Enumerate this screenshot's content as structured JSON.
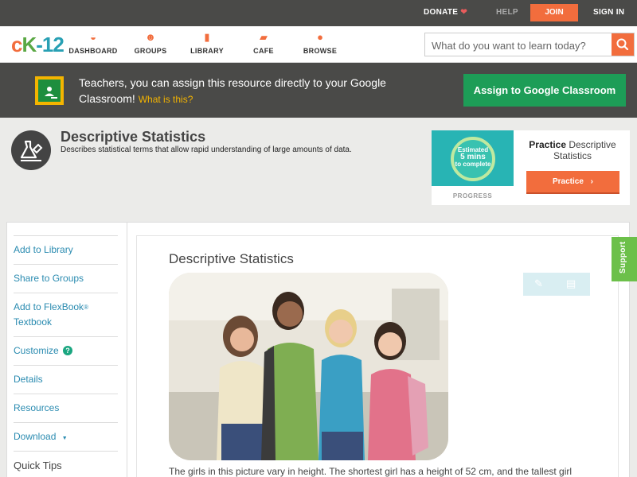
{
  "topbar": {
    "donate_label": "DONATE",
    "help_label": "HELP",
    "join_label": "JOIN",
    "signin_label": "SIGN IN"
  },
  "header": {
    "logo_c": "c",
    "logo_k": "K",
    "logo_n": "-12",
    "nav": [
      {
        "label": "DASHBOARD",
        "icon": "dashboard-icon"
      },
      {
        "label": "GROUPS",
        "icon": "groups-icon"
      },
      {
        "label": "LIBRARY",
        "icon": "library-icon"
      },
      {
        "label": "CAFE",
        "icon": "cafe-icon"
      },
      {
        "label": "BROWSE",
        "icon": "browse-icon"
      }
    ],
    "search_placeholder": "What do you want to learn today?"
  },
  "classroom_banner": {
    "text": "Teachers, you can assign this resource directly to your Google Classroom!",
    "what_link": "What is this?",
    "button_label": "Assign to Google Classroom"
  },
  "concept": {
    "title": "Descriptive Statistics",
    "subtitle": "Describes statistical terms that allow rapid understanding of large amounts of data."
  },
  "practice_card": {
    "estimate_line1": "Estimated",
    "estimate_line2": "5 mins",
    "estimate_line3": "to complete",
    "progress_label": "PROGRESS",
    "title_bold": "Practice",
    "title_rest": "Descriptive Statistics",
    "button_label": "Practice"
  },
  "sidebar": {
    "items": [
      {
        "label": "Add to Library"
      },
      {
        "label": "Share to Groups"
      },
      {
        "label": "Add to FlexBook",
        "sup": "®",
        "label2": "Textbook"
      },
      {
        "label": "Customize",
        "badge": "?"
      },
      {
        "label": "Details"
      },
      {
        "label": "Resources"
      },
      {
        "label": "Download",
        "caret": "▼"
      },
      {
        "label": "Quick Tips"
      }
    ]
  },
  "article": {
    "title": "Descriptive Statistics",
    "text": "The girls in this picture vary in height. The shortest girl has a height of 52 cm, and the tallest girl"
  },
  "support_label": "Support",
  "colors": {
    "accent": "#f26d3d",
    "link": "#2a8bb0",
    "classroom_green": "#1d9d57",
    "support_green": "#6cc04a"
  }
}
